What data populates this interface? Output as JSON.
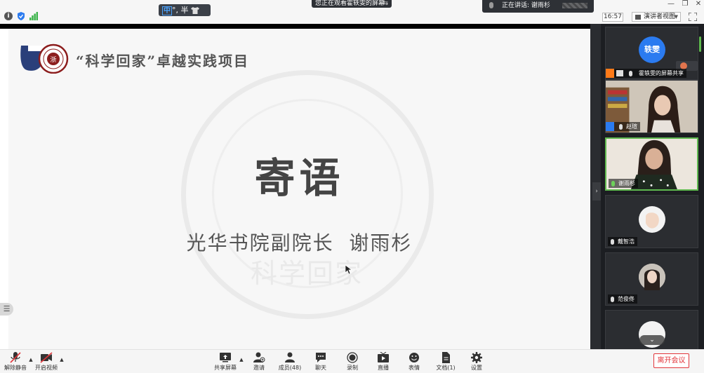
{
  "topbar": {
    "ime": {
      "mode": "中",
      "punct": "°, ",
      "width": "半"
    },
    "viewing_banner": "您正在观看霍轶雯的屏幕",
    "viewing_switch_icon": "switch-icon",
    "speaking_label": "正在讲话: 谢雨杉",
    "clock": "16:57",
    "view_mode": "演讲者视图"
  },
  "slide": {
    "header": "“科学回家”卓越实践项目",
    "title": "寄语",
    "subtitle": "光华书院副院长  谢雨杉",
    "watermark_text": "科学回家",
    "logo_char": "浙"
  },
  "participants": [
    {
      "avatar_text": "轶雯",
      "name": "霍轶雯的屏幕共享",
      "type": "share",
      "avatar_color": "#2b7bf0"
    },
    {
      "name": "赵瑄",
      "type": "host-video"
    },
    {
      "name": "谢雨杉",
      "type": "active-video"
    },
    {
      "name": "戴智浩",
      "type": "avatar-white"
    },
    {
      "name": "范俊佟",
      "type": "avatar-photo"
    },
    {
      "name": "",
      "type": "avatar-white"
    }
  ],
  "toolbar": {
    "unmute": "解除静音",
    "start_video": "开启视频",
    "share_screen": "共享屏幕",
    "invite": "邀请",
    "members": "成员(48)",
    "chat": "聊天",
    "record": "录制",
    "live": "直播",
    "reactions": "表情",
    "docs": "文档(1)",
    "settings": "设置",
    "leave": "离开会议"
  },
  "colors": {
    "accent": "#2b7bf0",
    "active_border": "#5fb94f",
    "leave": "#e2353a",
    "share_badge": "#ff7a18"
  }
}
